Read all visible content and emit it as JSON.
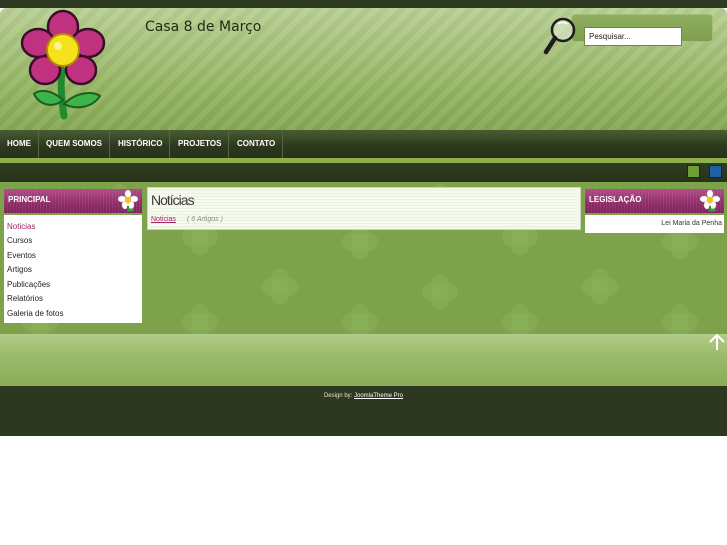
{
  "header": {
    "site_title": "Casa 8 de Março",
    "search_placeholder": "Pesquisar..."
  },
  "nav": {
    "items": [
      "HOME",
      "QUEM SOMOS",
      "HISTÓRICO",
      "PROJETOS",
      "CONTATO"
    ]
  },
  "color_switcher": {
    "swatches": [
      "#6e9d3a",
      "#1d5fa8"
    ]
  },
  "left_module": {
    "title": "PRINCIPAL",
    "items": [
      "Noticias",
      "Cursos",
      "Eventos",
      "Artigos",
      "Publicações",
      "Relatórios",
      "Galeria de fotos"
    ],
    "active_index": 0
  },
  "center": {
    "title": "Notícias",
    "category_link": "Noticias",
    "count": "( 6 Artigos )"
  },
  "right_module": {
    "title": "LEGISLAÇÃO",
    "ticker": "Lei Maria da Penha"
  },
  "footer": {
    "prefix": "Design by:",
    "link": "JoomlaTheme Pro"
  },
  "colors": {
    "accent_magenta": "#a0235f",
    "nav_dark": "#2d3a1e",
    "body_green": "#7ea24c"
  },
  "icons": {
    "logo": "flower-logo-icon",
    "search": "magnifier-icon",
    "module": "daisy-icon",
    "back_to_top": "up-arrow-icon"
  }
}
